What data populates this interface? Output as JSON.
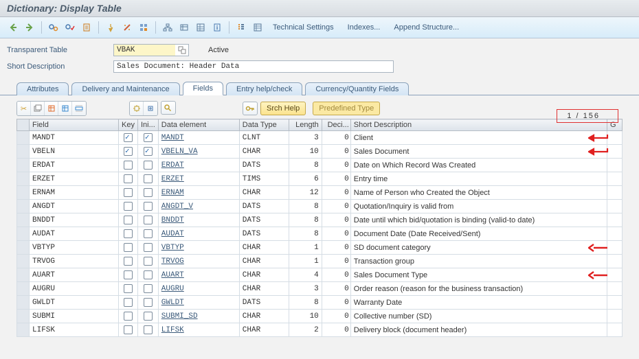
{
  "title": "Dictionary: Display Table",
  "toolbar_texts": {
    "tech": "Technical Settings",
    "idx": "Indexes...",
    "append": "Append Structure..."
  },
  "form": {
    "table_label": "Transparent Table",
    "table_value": "VBAK",
    "status": "Active",
    "shortdesc_label": "Short Description",
    "shortdesc_value": "Sales Document: Header Data"
  },
  "tabs": [
    "Attributes",
    "Delivery and Maintenance",
    "Fields",
    "Entry help/check",
    "Currency/Quantity Fields"
  ],
  "active_tab_index": 2,
  "grid_buttons": {
    "srch": "Srch Help",
    "pred": "Predefined Type"
  },
  "counter": "1 / 156",
  "columns": [
    "Field",
    "Key",
    "Ini...",
    "Data element",
    "Data Type",
    "Length",
    "Deci...",
    "Short Description",
    "G"
  ],
  "rows": [
    {
      "field": "MANDT",
      "key": true,
      "ini": true,
      "de": "MANDT",
      "dt": "CLNT",
      "len": 3,
      "dec": 0,
      "sd": "Client",
      "arrow": true
    },
    {
      "field": "VBELN",
      "key": true,
      "ini": true,
      "de": "VBELN_VA",
      "dt": "CHAR",
      "len": 10,
      "dec": 0,
      "sd": "Sales Document",
      "arrow": true
    },
    {
      "field": "ERDAT",
      "key": false,
      "ini": false,
      "de": "ERDAT",
      "dt": "DATS",
      "len": 8,
      "dec": 0,
      "sd": "Date on Which Record Was Created",
      "arrow": false
    },
    {
      "field": "ERZET",
      "key": false,
      "ini": false,
      "de": "ERZET",
      "dt": "TIMS",
      "len": 6,
      "dec": 0,
      "sd": "Entry time",
      "arrow": false
    },
    {
      "field": "ERNAM",
      "key": false,
      "ini": false,
      "de": "ERNAM",
      "dt": "CHAR",
      "len": 12,
      "dec": 0,
      "sd": "Name of Person who Created the Object",
      "arrow": false
    },
    {
      "field": "ANGDT",
      "key": false,
      "ini": false,
      "de": "ANGDT_V",
      "dt": "DATS",
      "len": 8,
      "dec": 0,
      "sd": "Quotation/Inquiry is valid from",
      "arrow": false
    },
    {
      "field": "BNDDT",
      "key": false,
      "ini": false,
      "de": "BNDDT",
      "dt": "DATS",
      "len": 8,
      "dec": 0,
      "sd": "Date until which bid/quotation is binding (valid-to date)",
      "arrow": false
    },
    {
      "field": "AUDAT",
      "key": false,
      "ini": false,
      "de": "AUDAT",
      "dt": "DATS",
      "len": 8,
      "dec": 0,
      "sd": "Document Date (Date Received/Sent)",
      "arrow": false
    },
    {
      "field": "VBTYP",
      "key": false,
      "ini": false,
      "de": "VBTYP",
      "dt": "CHAR",
      "len": 1,
      "dec": 0,
      "sd": "SD document category",
      "arrow": true
    },
    {
      "field": "TRVOG",
      "key": false,
      "ini": false,
      "de": "TRVOG",
      "dt": "CHAR",
      "len": 1,
      "dec": 0,
      "sd": "Transaction group",
      "arrow": false
    },
    {
      "field": "AUART",
      "key": false,
      "ini": false,
      "de": "AUART",
      "dt": "CHAR",
      "len": 4,
      "dec": 0,
      "sd": "Sales Document Type",
      "arrow": true
    },
    {
      "field": "AUGRU",
      "key": false,
      "ini": false,
      "de": "AUGRU",
      "dt": "CHAR",
      "len": 3,
      "dec": 0,
      "sd": "Order reason (reason for the business transaction)",
      "arrow": false
    },
    {
      "field": "GWLDT",
      "key": false,
      "ini": false,
      "de": "GWLDT",
      "dt": "DATS",
      "len": 8,
      "dec": 0,
      "sd": "Warranty Date",
      "arrow": false
    },
    {
      "field": "SUBMI",
      "key": false,
      "ini": false,
      "de": "SUBMI_SD",
      "dt": "CHAR",
      "len": 10,
      "dec": 0,
      "sd": "Collective number (SD)",
      "arrow": false
    },
    {
      "field": "LIFSK",
      "key": false,
      "ini": false,
      "de": "LIFSK",
      "dt": "CHAR",
      "len": 2,
      "dec": 0,
      "sd": "Delivery block (document header)",
      "arrow": false
    }
  ]
}
